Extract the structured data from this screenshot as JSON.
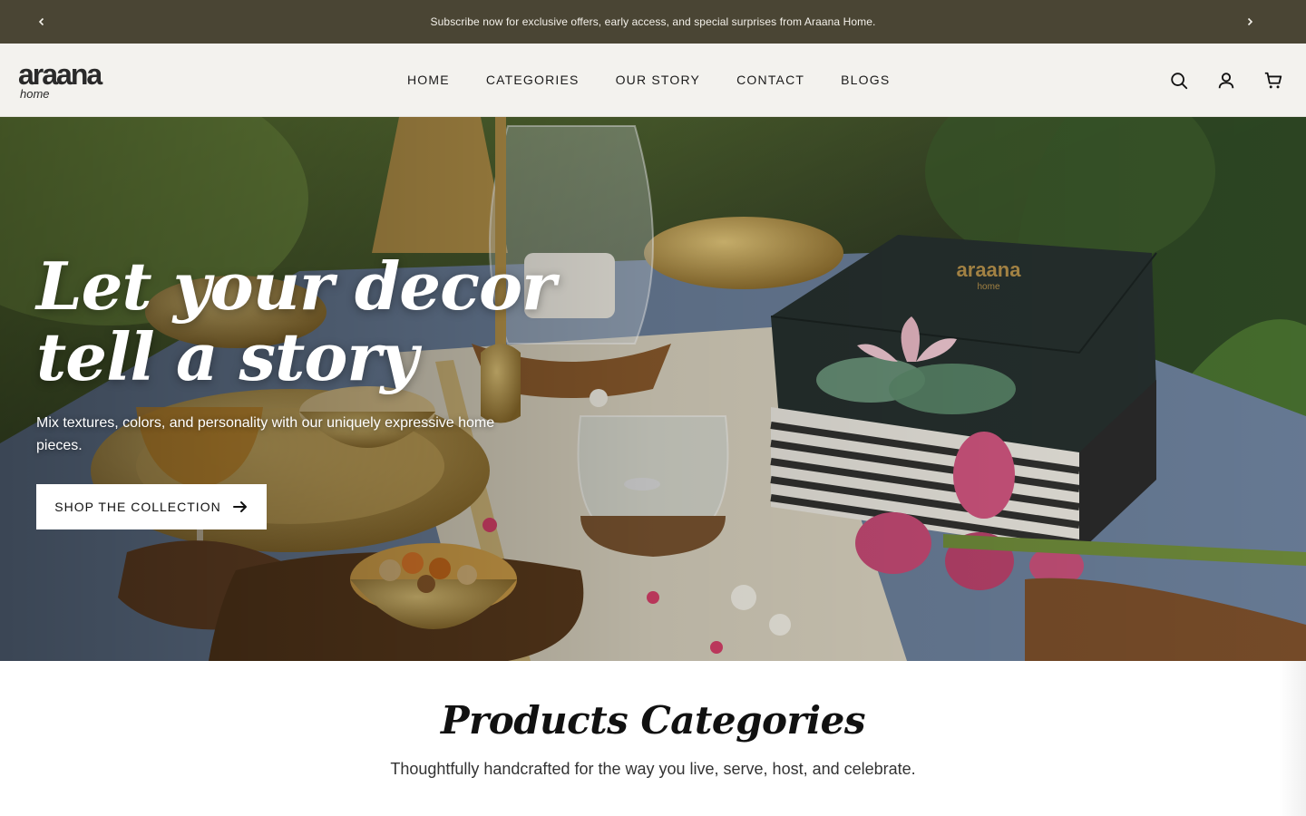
{
  "announcement": {
    "text": "Subscribe now for exclusive offers, early access, and special surprises from Araana Home.",
    "prev_icon": "chevron-left-icon",
    "next_icon": "chevron-right-icon"
  },
  "header": {
    "logo": {
      "main": "araana",
      "sub": "home"
    },
    "nav": [
      "HOME",
      "CATEGORIES",
      "OUR STORY",
      "CONTACT",
      "BLOGS"
    ],
    "icons": [
      "search-icon",
      "account-icon",
      "cart-icon"
    ]
  },
  "hero": {
    "title_line1": "Let your decor",
    "title_line2": "tell a story",
    "subtitle": "Mix textures, colors, and personality with our uniquely expressive home pieces.",
    "button_label": "SHOP THE COLLECTION",
    "image_alt": "Table set with brass bowls, glass candle holders, lotus flowers and an araana home gift box",
    "box_brand": "araana",
    "box_sub": "home"
  },
  "categories": {
    "title": "Products Categories",
    "subtitle": "Thoughtfully handcrafted for the way you live, serve, host, and celebrate."
  },
  "colors": {
    "announcement_bg": "#4a4534",
    "header_bg": "#f3f2ee",
    "button_bg": "#ffffff"
  }
}
